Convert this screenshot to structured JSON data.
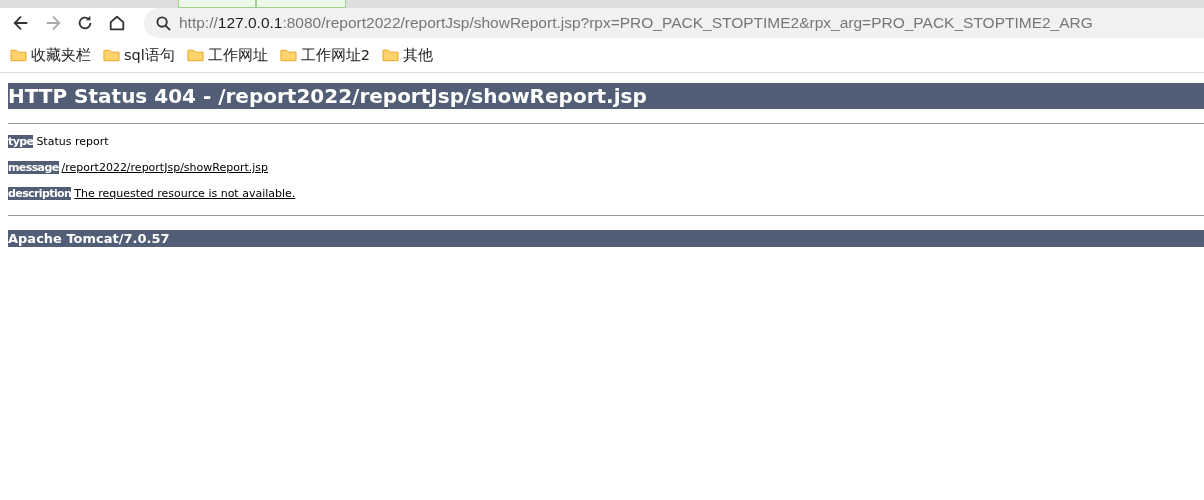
{
  "toolbar": {
    "address": [
      {
        "kind": "dim",
        "text": "http://"
      },
      {
        "kind": "host",
        "text": "127.0.0.1"
      },
      {
        "kind": "dim",
        "text": ":8080/report2022/reportJsp/showReport.jsp?rpx=PRO_PACK_STOPTIME2&rpx_arg=PRO_PACK_STOPTIME2_ARG"
      }
    ],
    "forward_disabled": true
  },
  "bookmarks": [
    {
      "label": "收藏夹栏"
    },
    {
      "label": "sql语句"
    },
    {
      "label": "工作网址"
    },
    {
      "label": "工作网址2"
    },
    {
      "label": "其他"
    }
  ],
  "page": {
    "heading": "HTTP Status 404 - /report2022/reportJsp/showReport.jsp",
    "fields": [
      {
        "label": "type",
        "value": "Status report",
        "underlined": false
      },
      {
        "label": "message",
        "value": "/report2022/reportJsp/showReport.jsp",
        "underlined": true
      },
      {
        "label": "description",
        "value": "The requested resource is not available.",
        "underlined": true
      }
    ],
    "footer": "Apache Tomcat/7.0.57"
  }
}
